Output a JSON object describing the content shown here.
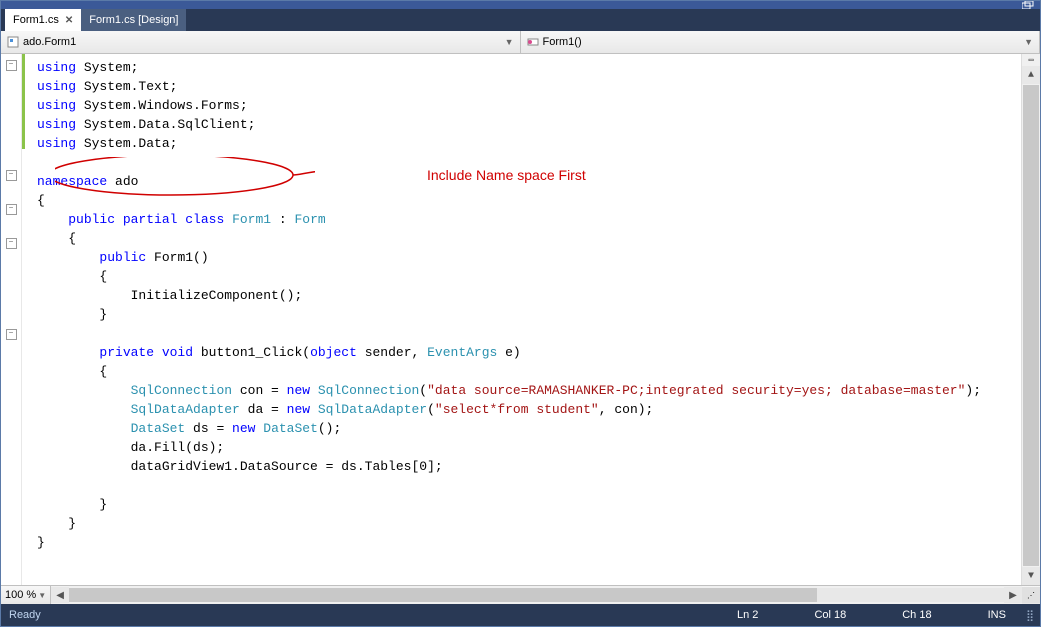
{
  "tabs": [
    {
      "label": "Form1.cs",
      "active": true
    },
    {
      "label": "Form1.cs [Design]",
      "active": false
    }
  ],
  "dropdowns": {
    "left": "ado.Form1",
    "right": "Form1()"
  },
  "annotation": "Include Name space First",
  "code_tokens": [
    [
      [
        "kw",
        "using"
      ],
      [
        "",
        " System;"
      ]
    ],
    [
      [
        "kw",
        "using"
      ],
      [
        "",
        " System.Text;"
      ]
    ],
    [
      [
        "kw",
        "using"
      ],
      [
        "",
        " System.Windows.Forms;"
      ]
    ],
    [
      [
        "kw",
        "using"
      ],
      [
        "",
        " System.Data.SqlClient;"
      ]
    ],
    [
      [
        "kw",
        "using"
      ],
      [
        "",
        " System.Data;"
      ]
    ],
    [
      [
        "",
        ""
      ]
    ],
    [
      [
        "kw",
        "namespace"
      ],
      [
        "",
        " ado"
      ]
    ],
    [
      [
        "",
        "{"
      ]
    ],
    [
      [
        "",
        "    "
      ],
      [
        "kw",
        "public partial class"
      ],
      [
        "",
        " "
      ],
      [
        "type",
        "Form1"
      ],
      [
        "",
        " : "
      ],
      [
        "type",
        "Form"
      ]
    ],
    [
      [
        "",
        "    {"
      ]
    ],
    [
      [
        "",
        "        "
      ],
      [
        "kw",
        "public"
      ],
      [
        "",
        " Form1()"
      ]
    ],
    [
      [
        "",
        "        {"
      ]
    ],
    [
      [
        "",
        "            InitializeComponent();"
      ]
    ],
    [
      [
        "",
        "        }"
      ]
    ],
    [
      [
        "",
        ""
      ]
    ],
    [
      [
        "",
        "        "
      ],
      [
        "kw",
        "private void"
      ],
      [
        "",
        " button1_Click("
      ],
      [
        "kw",
        "object"
      ],
      [
        "",
        " sender, "
      ],
      [
        "type",
        "EventArgs"
      ],
      [
        "",
        " e)"
      ]
    ],
    [
      [
        "",
        "        {"
      ]
    ],
    [
      [
        "",
        "            "
      ],
      [
        "type",
        "SqlConnection"
      ],
      [
        "",
        " con = "
      ],
      [
        "kw",
        "new"
      ],
      [
        "",
        " "
      ],
      [
        "type",
        "SqlConnection"
      ],
      [
        "",
        "("
      ],
      [
        "str",
        "\"data source=RAMASHANKER-PC;integrated security=yes; database=master\""
      ],
      [
        "",
        ");"
      ]
    ],
    [
      [
        "",
        "            "
      ],
      [
        "type",
        "SqlDataAdapter"
      ],
      [
        "",
        " da = "
      ],
      [
        "kw",
        "new"
      ],
      [
        "",
        " "
      ],
      [
        "type",
        "SqlDataAdapter"
      ],
      [
        "",
        "("
      ],
      [
        "str",
        "\"select*from student\""
      ],
      [
        "",
        ", con);"
      ]
    ],
    [
      [
        "",
        "            "
      ],
      [
        "type",
        "DataSet"
      ],
      [
        "",
        " ds = "
      ],
      [
        "kw",
        "new"
      ],
      [
        "",
        " "
      ],
      [
        "type",
        "DataSet"
      ],
      [
        "",
        "();"
      ]
    ],
    [
      [
        "",
        "            da.Fill(ds);"
      ]
    ],
    [
      [
        "",
        "            dataGridView1.DataSource = ds.Tables[0];"
      ]
    ],
    [
      [
        "",
        ""
      ]
    ],
    [
      [
        "",
        "        }"
      ]
    ],
    [
      [
        "",
        "    }"
      ]
    ],
    [
      [
        "",
        "}"
      ]
    ]
  ],
  "zoom": "100 %",
  "status": {
    "left": "Ready",
    "line": "Ln 2",
    "col": "Col 18",
    "ch": "Ch 18",
    "ins": "INS"
  }
}
